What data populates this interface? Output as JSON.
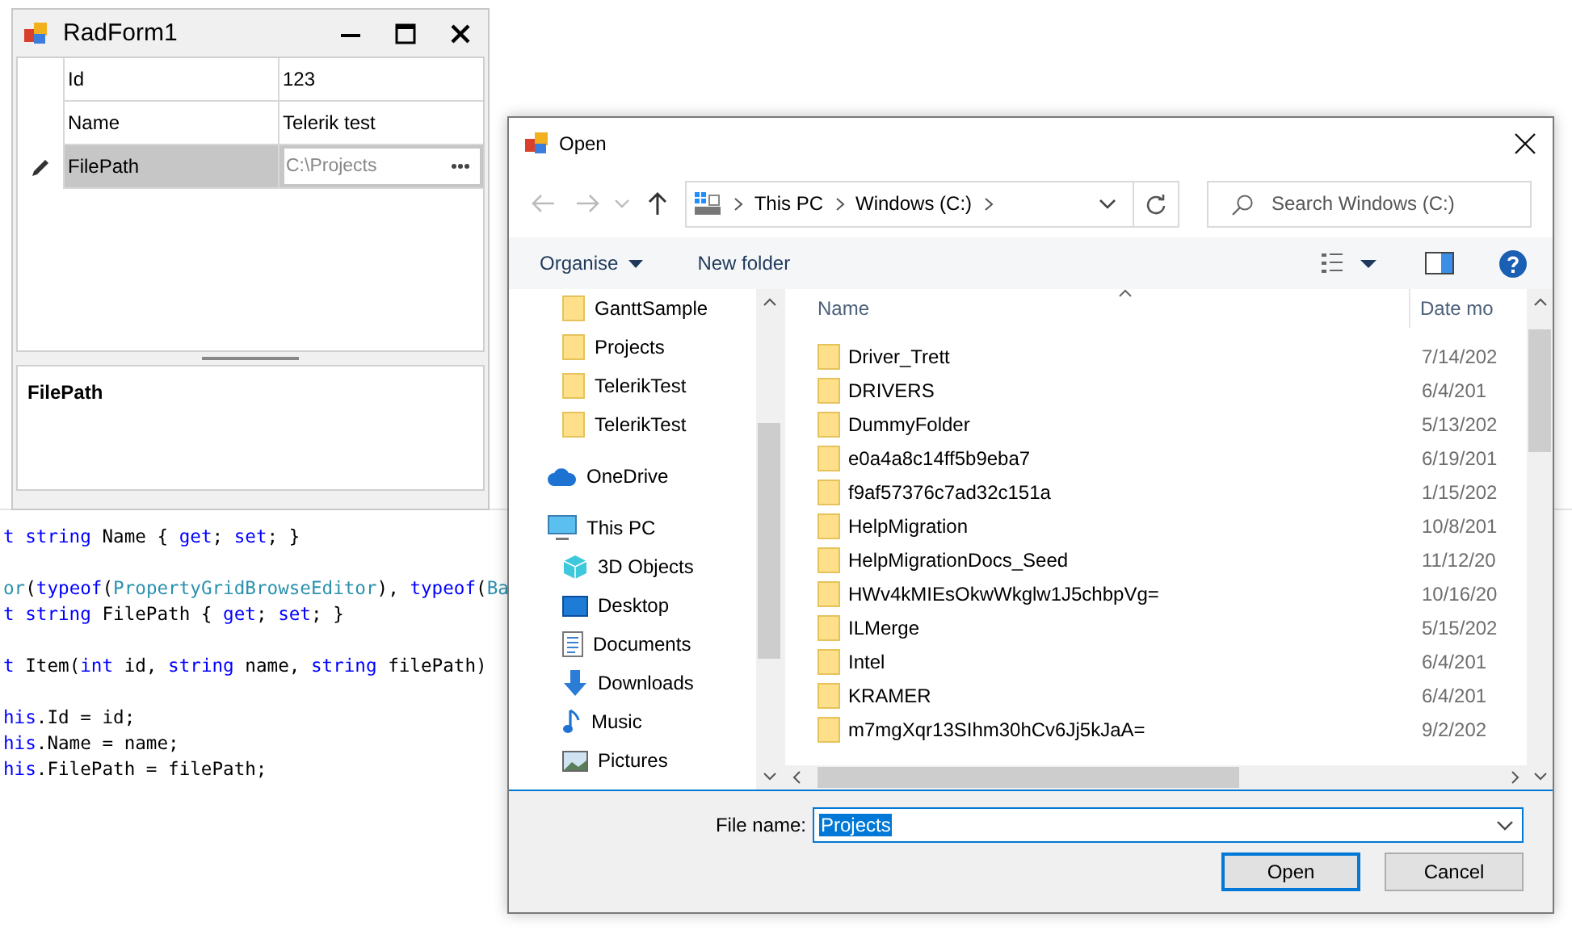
{
  "editor": {
    "lines": [
      {
        "kind": "code",
        "tokens": [
          {
            "kind": "keyword",
            "text": "t string"
          },
          {
            "kind": "plain",
            "text": " Name { "
          },
          {
            "kind": "keyword",
            "text": "get"
          },
          {
            "kind": "plain",
            "text": "; "
          },
          {
            "kind": "keyword",
            "text": "set"
          },
          {
            "kind": "plain",
            "text": "; }"
          }
        ]
      },
      {
        "kind": "blank"
      },
      {
        "kind": "code",
        "tokens": [
          {
            "kind": "type",
            "text": "or"
          },
          {
            "kind": "plain",
            "text": "("
          },
          {
            "kind": "keyword",
            "text": "typeof"
          },
          {
            "kind": "plain",
            "text": "("
          },
          {
            "kind": "type",
            "text": "PropertyGridBrowseEditor"
          },
          {
            "kind": "plain",
            "text": "), "
          },
          {
            "kind": "keyword",
            "text": "typeof"
          },
          {
            "kind": "plain",
            "text": "("
          },
          {
            "kind": "type",
            "text": "Ba"
          }
        ]
      },
      {
        "kind": "code",
        "tokens": [
          {
            "kind": "keyword",
            "text": "t string"
          },
          {
            "kind": "plain",
            "text": " FilePath { "
          },
          {
            "kind": "keyword",
            "text": "get"
          },
          {
            "kind": "plain",
            "text": "; "
          },
          {
            "kind": "keyword",
            "text": "set"
          },
          {
            "kind": "plain",
            "text": "; }"
          }
        ]
      },
      {
        "kind": "blank"
      },
      {
        "kind": "code",
        "tokens": [
          {
            "kind": "keyword",
            "text": "t"
          },
          {
            "kind": "plain",
            "text": " Item("
          },
          {
            "kind": "keyword",
            "text": "int"
          },
          {
            "kind": "plain",
            "text": " id, "
          },
          {
            "kind": "keyword",
            "text": "string"
          },
          {
            "kind": "plain",
            "text": " name, "
          },
          {
            "kind": "keyword",
            "text": "string"
          },
          {
            "kind": "plain",
            "text": " filePath)"
          }
        ]
      },
      {
        "kind": "blank"
      },
      {
        "kind": "code",
        "tokens": [
          {
            "kind": "keyword",
            "text": "his"
          },
          {
            "kind": "plain",
            "text": ".Id = id;"
          }
        ]
      },
      {
        "kind": "code",
        "tokens": [
          {
            "kind": "keyword",
            "text": "his"
          },
          {
            "kind": "plain",
            "text": ".Name = name;"
          }
        ]
      },
      {
        "kind": "code",
        "tokens": [
          {
            "kind": "keyword",
            "text": "his"
          },
          {
            "kind": "plain",
            "text": ".FilePath = filePath;"
          }
        ]
      }
    ]
  },
  "form": {
    "title": "RadForm1",
    "properties": [
      {
        "name": "Id",
        "value": "123",
        "selected": false
      },
      {
        "name": "Name",
        "value": "Telerik test",
        "selected": false
      },
      {
        "name": "FilePath",
        "value": "C:\\Projects",
        "selected": true
      }
    ],
    "description": "FilePath"
  },
  "dialog": {
    "title": "Open",
    "breadcrumb": [
      "This PC",
      "Windows (C:)"
    ],
    "search": {
      "placeholder": "Search Windows (C:)"
    },
    "toolbar": {
      "organise": "Organise",
      "new_folder": "New folder"
    },
    "nav": {
      "quick_access_children": [
        {
          "label": "GanttSample",
          "kind": "folder"
        },
        {
          "label": "Projects",
          "kind": "folder"
        },
        {
          "label": "TelerikTest",
          "kind": "folder"
        },
        {
          "label": "TelerikTest",
          "kind": "folder"
        }
      ],
      "items": [
        {
          "label": "OneDrive",
          "kind": "cloud"
        },
        {
          "label": "This PC",
          "kind": "pc",
          "children": [
            {
              "label": "3D Objects",
              "kind": "cube"
            },
            {
              "label": "Desktop",
              "kind": "desktop"
            },
            {
              "label": "Documents",
              "kind": "document"
            },
            {
              "label": "Downloads",
              "kind": "download"
            },
            {
              "label": "Music",
              "kind": "music"
            },
            {
              "label": "Pictures",
              "kind": "pictures"
            }
          ]
        }
      ]
    },
    "columns": [
      "Name",
      "Date mo"
    ],
    "files": [
      {
        "name": "Driver_Trett",
        "date": "7/14/202"
      },
      {
        "name": "DRIVERS",
        "date": "6/4/201"
      },
      {
        "name": "DummyFolder",
        "date": "5/13/202"
      },
      {
        "name": "e0a4a8c14ff5b9eba7",
        "date": "6/19/201"
      },
      {
        "name": "f9af57376c7ad32c151a",
        "date": "1/15/202"
      },
      {
        "name": "HelpMigration",
        "date": "10/8/201"
      },
      {
        "name": "HelpMigrationDocs_Seed",
        "date": "11/12/20"
      },
      {
        "name": "HWv4kMIEsOkwWkglw1J5chbpVg=",
        "date": "10/16/20"
      },
      {
        "name": "ILMerge",
        "date": "5/15/202"
      },
      {
        "name": "Intel",
        "date": "6/4/201"
      },
      {
        "name": "KRAMER",
        "date": "6/4/201"
      },
      {
        "name": "m7mgXqr13SIhm30hCv6Jj5kJaA=",
        "date": "9/2/202"
      }
    ],
    "file_name_label": "File name:",
    "file_name": "Projects",
    "buttons": {
      "open": "Open",
      "cancel": "Cancel"
    }
  }
}
